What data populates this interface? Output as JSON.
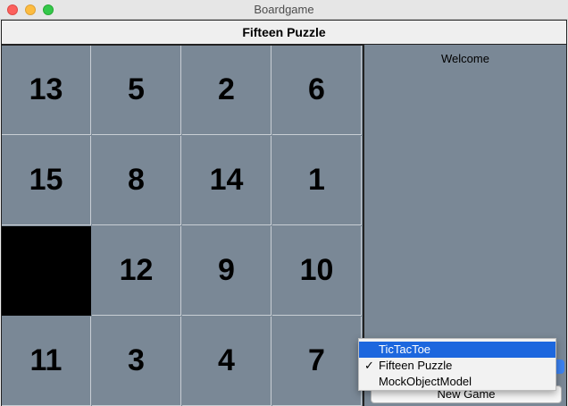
{
  "window": {
    "title": "Boardgame"
  },
  "game": {
    "title": "Fifteen Puzzle"
  },
  "board": {
    "rows": [
      [
        "13",
        "5",
        "2",
        "6"
      ],
      [
        "15",
        "8",
        "14",
        "1"
      ],
      [
        "",
        "12",
        "9",
        "10"
      ],
      [
        "11",
        "3",
        "4",
        "7"
      ]
    ]
  },
  "side": {
    "message": "Welcome"
  },
  "controls": {
    "new_game_label": "New Game"
  },
  "menu": {
    "items": [
      {
        "label": "TicTacToe",
        "highlighted": true,
        "checked": false
      },
      {
        "label": "Fifteen Puzzle",
        "highlighted": false,
        "checked": true
      },
      {
        "label": "MockObjectModel",
        "highlighted": false,
        "checked": false
      }
    ],
    "check_glyph": "✓"
  },
  "colors": {
    "tile": "#7a8896",
    "empty_tile": "#000000",
    "menu_highlight": "#1d67de"
  }
}
